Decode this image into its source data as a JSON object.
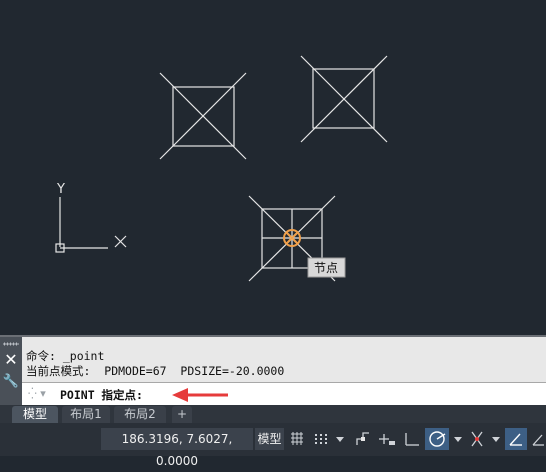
{
  "viewport": {
    "background": "#212830",
    "tooltip": "节点",
    "ucs": {
      "y_label": "Y"
    }
  },
  "command_line": {
    "history": [
      "命令: _point",
      "当前点模式:  PDMODE=67  PDSIZE=-20.0000"
    ],
    "prompt": "POINT 指定点:"
  },
  "tabs": [
    {
      "label": "模型",
      "active": true
    },
    {
      "label": "布局1",
      "active": false
    },
    {
      "label": "布局2",
      "active": false
    },
    {
      "label": "+",
      "active": false
    }
  ],
  "statusbar": {
    "coordinates": "186.3196, 7.6027, 0.0000",
    "space": "模型",
    "icons": [
      "grid-icon",
      "snap-icon",
      "ortho-icon",
      "polar-icon",
      "isodraft-icon",
      "osnap-icon",
      "otrack-icon",
      "dynamic-ucs-icon"
    ]
  },
  "colors": {
    "accent": "#2b7fd6",
    "marker": "#f0a04b",
    "arrow": "#e63b3b"
  }
}
